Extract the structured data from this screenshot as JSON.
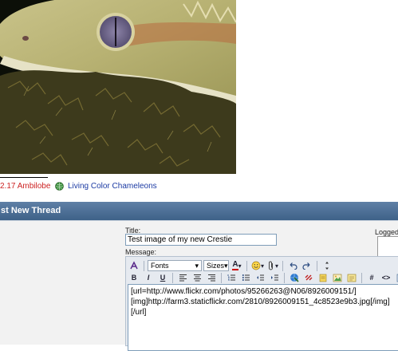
{
  "signature": {
    "prefix": "2.17 Ambilobe",
    "link": "Living Color Chameleons",
    "link_color": "#1b3aa3",
    "prefix_color": "#cc2222",
    "globe_icon": "globe-icon"
  },
  "thread_header": {
    "title": "st New Thread",
    "bg_color": "#4a6d93"
  },
  "form": {
    "title_label": "Title:",
    "title_value": "Test image of my new Crestie",
    "logged_label": "Logged",
    "message_label": "Message:"
  },
  "toolbar": {
    "font_select": "Fonts",
    "size_select": "Sizes",
    "font_color_letter": "A",
    "bold": "B",
    "italic": "I",
    "underline": "U",
    "hash": "#",
    "code": "<>"
  },
  "message": {
    "text": "[url=http://www.flickr.com/photos/95266263@N06/8926009151/]\n[img]http://farm3.staticflickr.com/2810/8926009151_4c8523e9b3.jpg[/img]\n[/url]"
  }
}
